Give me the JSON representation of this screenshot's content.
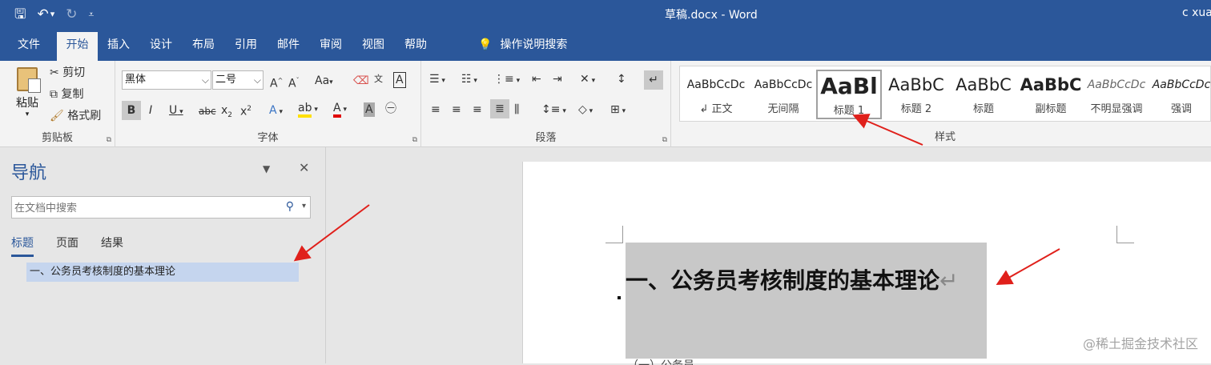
{
  "titlebar": {
    "doc_title": "草稿.docx  -  Word",
    "user": "c xuan"
  },
  "qat": {
    "save": "🖫",
    "undo": "↶",
    "undo_dd": "▾",
    "redo": "↻",
    "customize": "⩡"
  },
  "tabs": [
    "文件",
    "开始",
    "插入",
    "设计",
    "布局",
    "引用",
    "邮件",
    "审阅",
    "视图",
    "帮助"
  ],
  "tell_me": {
    "icon": "💡",
    "label": "操作说明搜索"
  },
  "clipboard": {
    "paste": "粘贴",
    "cut": "剪切",
    "copy": "复制",
    "format_painter": "格式刷",
    "label": "剪贴板"
  },
  "font": {
    "font_name": "黑体",
    "font_size": "二号",
    "label": "字体"
  },
  "paragraph": {
    "label": "段落"
  },
  "styles": {
    "label": "样式",
    "items": [
      {
        "preview": "AaBbCcDc",
        "name": "↲ 正文"
      },
      {
        "preview": "AaBbCcDc",
        "name": "无间隔"
      },
      {
        "preview": "AaBl",
        "name": "标题 1"
      },
      {
        "preview": "AaBbC",
        "name": "标题 2"
      },
      {
        "preview": "AaBbC",
        "name": "标题"
      },
      {
        "preview": "AaBbC",
        "name": "副标题"
      },
      {
        "preview": "AaBbCcDc",
        "name": "不明显强调"
      },
      {
        "preview": "AaBbCcDc",
        "name": "强调"
      }
    ]
  },
  "nav": {
    "title": "导航",
    "search_placeholder": "在文档中搜索",
    "tabs": [
      "标题",
      "页面",
      "结果"
    ],
    "heading_item": "一、公务员考核制度的基本理论"
  },
  "document": {
    "heading": "一、公务员考核制度的基本理论",
    "pilcrow": "↵",
    "next_line": "（一）公务员"
  },
  "watermark": "@稀土掘金技术社区",
  "colors": {
    "brand": "#2b579a",
    "arrow": "#e0201b",
    "selection": "#c8c8c8",
    "nav_highlight": "#c5d5ee"
  }
}
